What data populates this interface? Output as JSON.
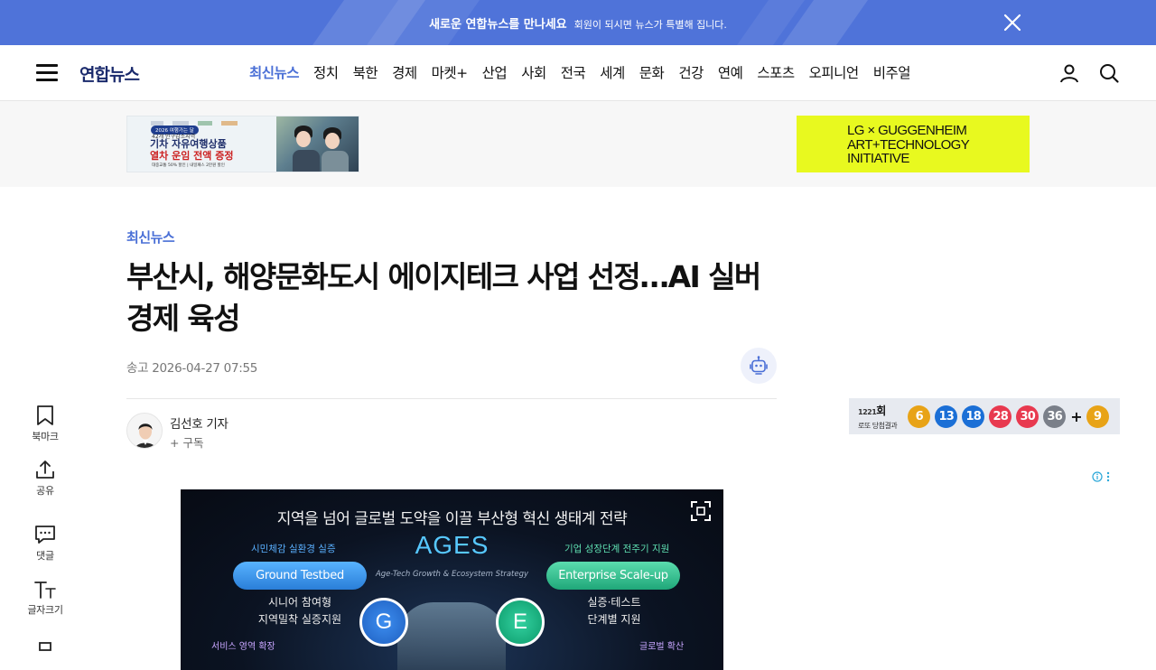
{
  "promo": {
    "title": "새로운 연합뉴스를 만나세요",
    "subtitle": "회원이 되시면 뉴스가 특별해 집니다."
  },
  "header": {
    "logo": "연합뉴스",
    "nav": [
      "최신뉴스",
      "정치",
      "북한",
      "경제",
      "마켓+",
      "산업",
      "사회",
      "전국",
      "세계",
      "문화",
      "건강",
      "연예",
      "스포츠",
      "오피니언",
      "비주얼"
    ],
    "active_nav": "최신뉴스"
  },
  "ads": {
    "left": {
      "badge": "2026 여행가는 달",
      "line0": "42개 인구감소지역",
      "line1": "기차 자유여행상품",
      "line2": "열차 운임 전액 증정",
      "line3": "대중교통 50% 할인 | 내일패스 2만원 할인"
    },
    "right": {
      "line1": "LG × GUGGENHEIM",
      "line2": "ART+TECHNOLOGY",
      "line3": "INITIATIVE"
    }
  },
  "article": {
    "category": "최신뉴스",
    "headline": "부산시, 해양문화도시 에이지테크 사업 선정…AI 실버경제 육성",
    "date": "송고 2026-04-27 07:55",
    "author": "김선호 기자",
    "subscribe": "+ 구독"
  },
  "rail": {
    "bookmark": "북마크",
    "share": "공유",
    "comment": "댓글",
    "fontsize": "글자크기"
  },
  "lotto": {
    "round_num": "1221",
    "round_suffix": "회",
    "label": "로또 당첨결과",
    "numbers": [
      {
        "n": "6",
        "color": "#e8a317"
      },
      {
        "n": "13",
        "color": "#1b6fd6"
      },
      {
        "n": "18",
        "color": "#1b6fd6"
      },
      {
        "n": "28",
        "color": "#e8394f"
      },
      {
        "n": "30",
        "color": "#e8394f"
      },
      {
        "n": "36",
        "color": "#7a7f89"
      }
    ],
    "plus": "+",
    "bonus": {
      "n": "9",
      "color": "#e8a317"
    }
  },
  "figure": {
    "title": "지역을 넘어 글로벌 도약을 이끌 부산형 혁신 생태계 전략",
    "ages": "AGES",
    "ages_sub": "Age-Tech Growth & Ecosystem Strategy",
    "left_label": "시민체감 실환경 실증",
    "right_label": "기업 성장단계 전주기 지원",
    "left_button": "Ground Testbed",
    "right_button": "Enterprise Scale-up",
    "left_text1": "시니어 참여형",
    "left_text2": "지역밀착 실증지원",
    "right_text1": "실증·테스트",
    "right_text2": "단계별 지원",
    "circle_g": "G",
    "circle_e": "E",
    "bottom_left": "서비스 영역 확장",
    "bottom_right": "글로벌 확산"
  },
  "colors": {
    "accent": "#4a6fd6",
    "promo_bg": "#4f73d9",
    "ad_yellow": "#e8f91f"
  }
}
